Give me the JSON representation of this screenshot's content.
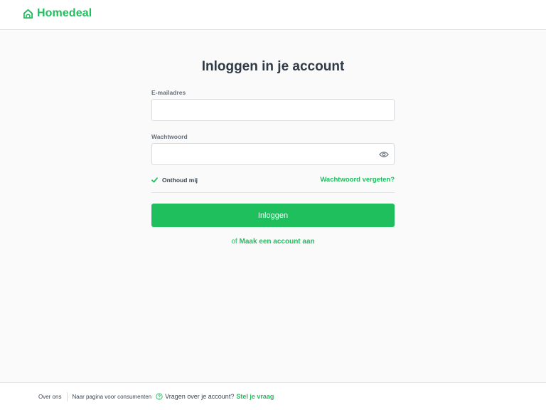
{
  "header": {
    "brand_name": "Homedeal",
    "logo_icon": "house-icon"
  },
  "login": {
    "title": "Inloggen in je account",
    "email_label": "E-mailadres",
    "email_value": "",
    "email_placeholder": "",
    "password_label": "Wachtwoord",
    "password_value": "",
    "password_placeholder": "",
    "show_password_icon": "eye-icon",
    "remember_label": "Onthoud mij",
    "remember_checked": true,
    "forgot_label": "Wachtwoord vergeten?",
    "submit_label": "Inloggen",
    "signup_prefix": "of",
    "signup_link": "Maak een account aan"
  },
  "footer": {
    "about": "Over ons",
    "consumer": "Naar pagina voor consumenten",
    "help_icon": "question-circle-icon",
    "question": "Vragen over je account?",
    "ask": "Stel je vraag"
  },
  "colors": {
    "accent": "#1fbf5e",
    "text": "#2f3a46",
    "background": "#fafafa"
  }
}
